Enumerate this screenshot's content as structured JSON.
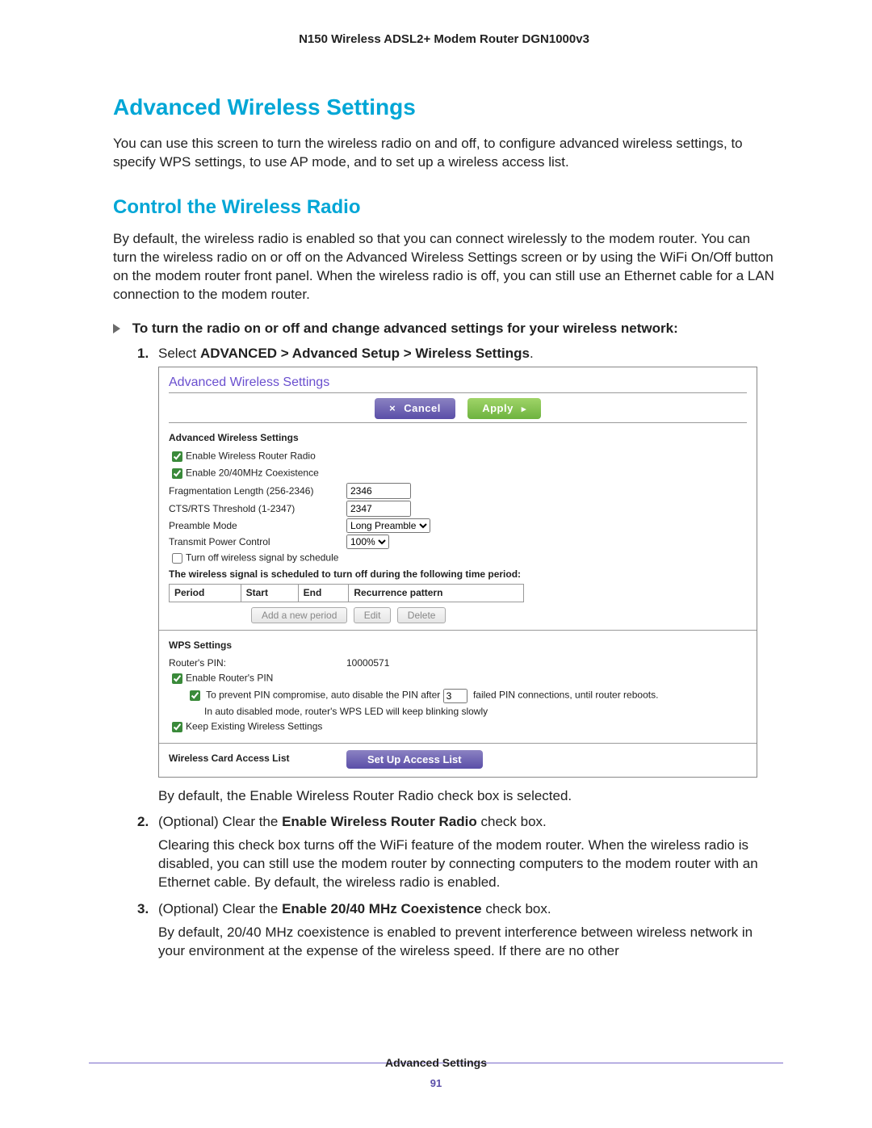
{
  "header": {
    "title": "N150 Wireless ADSL2+ Modem Router DGN1000v3"
  },
  "h1": "Advanced Wireless Settings",
  "intro": "You can use this screen to turn the wireless radio on and off, to configure advanced wireless settings, to specify WPS settings, to use AP mode, and to set up a wireless access list.",
  "h2": "Control the Wireless Radio",
  "p2": "By default, the wireless radio is enabled so that you can connect wirelessly to the modem router. You can turn the wireless radio on or off on the Advanced Wireless Settings screen or by using the WiFi On/Off button on the modem router front panel. When the wireless radio is off, you can still use an Ethernet cable for a LAN connection to the modem router.",
  "lead": "To turn the radio on or off and change advanced settings for your wireless network:",
  "step1": {
    "pre": "Select ",
    "bold": "ADVANCED > Advanced Setup > Wireless Settings",
    "post": "."
  },
  "ui": {
    "title": "Advanced Wireless Settings",
    "cancel": "Cancel",
    "apply": "Apply",
    "aws_head": "Advanced Wireless Settings",
    "enable_radio": "Enable Wireless Router Radio",
    "enable_coex": "Enable 20/40MHz Coexistence",
    "frag_lbl": "Fragmentation Length (256-2346)",
    "frag_val": "2346",
    "cts_lbl": "CTS/RTS Threshold (1-2347)",
    "cts_val": "2347",
    "preamble_lbl": "Preamble Mode",
    "preamble_val": "Long Preamble",
    "tx_lbl": "Transmit Power Control",
    "tx_val": "100%",
    "turnoff_sched": "Turn off wireless signal by schedule",
    "sched_note": "The wireless signal is scheduled to turn off during the following time period:",
    "sched_cols": {
      "period": "Period",
      "start": "Start",
      "end": "End",
      "recur": "Recurrence pattern"
    },
    "btn_add": "Add a new period",
    "btn_edit": "Edit",
    "btn_delete": "Delete",
    "wps_head": "WPS Settings",
    "router_pin_lbl": "Router's PIN:",
    "router_pin_val": "10000571",
    "enable_pin": "Enable Router's PIN",
    "prevent_pre": "To prevent PIN compromise, auto disable the PIN after",
    "prevent_val": "3",
    "prevent_post": "failed PIN connections, until router reboots.",
    "auto_note": "In auto disabled mode, router's WPS LED will keep blinking slowly",
    "keep_exist": "Keep Existing Wireless Settings",
    "wacl_head": "Wireless Card Access List",
    "setup_btn": "Set Up Access List"
  },
  "step1_after": "By default, the Enable Wireless Router Radio check box is selected.",
  "step2": {
    "pre": "(Optional) Clear the ",
    "bold": "Enable Wireless Router Radio",
    "post": " check box.",
    "para": "Clearing this check box turns off the WiFi feature of the modem router. When the wireless radio is disabled, you can still use the modem router by connecting computers to the modem router with an Ethernet cable. By default, the wireless radio is enabled."
  },
  "step3": {
    "pre": "(Optional) Clear the ",
    "bold": "Enable 20/40 MHz Coexistence",
    "post": " check box.",
    "para": "By default, 20/40 MHz coexistence is enabled to prevent interference between wireless network in your environment at the expense of the wireless speed. If there are no other"
  },
  "footer": {
    "section": "Advanced Settings",
    "page": "91"
  }
}
